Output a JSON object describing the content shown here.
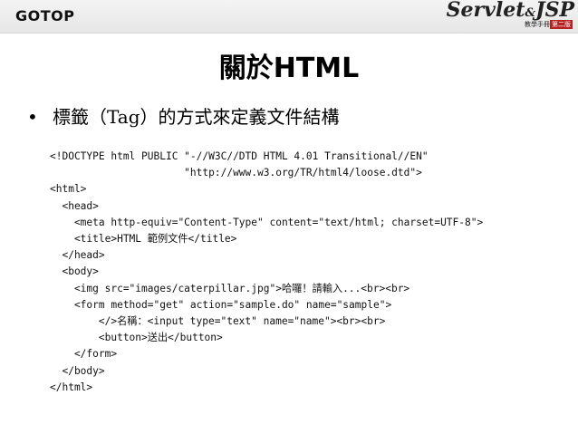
{
  "header": {
    "left_logo": "GOTOP",
    "brand_servlet": "Servlet",
    "brand_amp": "&",
    "brand_jsp": "JSP",
    "brand_sub": "教學手冊",
    "brand_edition": "第二版"
  },
  "slide": {
    "title": "關於HTML",
    "bullet_marker": "•",
    "bullet_text": "標籤（Tag）的方式來定義文件結構"
  },
  "code_lines": [
    "<!DOCTYPE html PUBLIC \"-//W3C//DTD HTML 4.01 Transitional//EN\"",
    "                      \"http://www.w3.org/TR/html4/loose.dtd\">",
    "<html>",
    "  <head>",
    "    <meta http-equiv=\"Content-Type\" content=\"text/html; charset=UTF-8\">",
    "    <title>HTML 範例文件</title>",
    "  </head>",
    "  <body>",
    "    <img src=\"images/caterpillar.jpg\">哈囉！請輸入...<br><br>",
    "    <form method=\"get\" action=\"sample.do\" name=\"sample\">",
    "        </>名稱：<input type=\"text\" name=\"name\"><br><br>",
    "        <button>送出</button>",
    "    </form>",
    "  </body>",
    "</html>"
  ]
}
